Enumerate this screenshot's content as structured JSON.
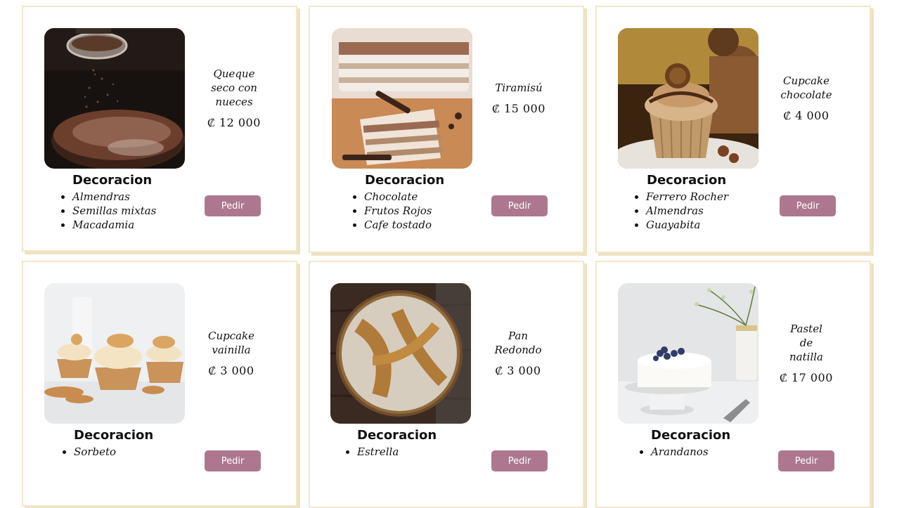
{
  "decoration_heading": "Decoracion",
  "order_button_label": "Pedir",
  "products": [
    {
      "name": "Queque seco con nueces",
      "price": "₡ 12 000",
      "image": "cake-cocoa-sifting-photo",
      "decorations": [
        "Almendras",
        "Semillas mixtas",
        "Macadamia"
      ]
    },
    {
      "name": "Tiramisú",
      "price": "₡ 15 000",
      "image": "tiramisu-photo",
      "decorations": [
        "Chocolate",
        "Frutos Rojos",
        "Cafe tostado"
      ]
    },
    {
      "name": "Cupcake chocolate",
      "price": "₡ 4 000",
      "image": "chocolate-cupcake-photo",
      "decorations": [
        "Ferrero Rocher",
        "Almendras",
        "Guayabita"
      ]
    },
    {
      "name": "Cupcake vainilla",
      "price": "₡ 3 000",
      "image": "vanilla-cupcakes-photo",
      "decorations": [
        "Sorbeto"
      ]
    },
    {
      "name": "Pan Redondo",
      "price": "₡ 3 000",
      "image": "round-bread-photo",
      "decorations": [
        "Estrella"
      ]
    },
    {
      "name": "Pastel de natilla",
      "price": "₡ 17 000",
      "image": "cream-cake-photo",
      "decorations": [
        "Arandanos"
      ]
    }
  ],
  "colors": {
    "accent": "#ad788f",
    "card_border": "#f3e7c9"
  }
}
